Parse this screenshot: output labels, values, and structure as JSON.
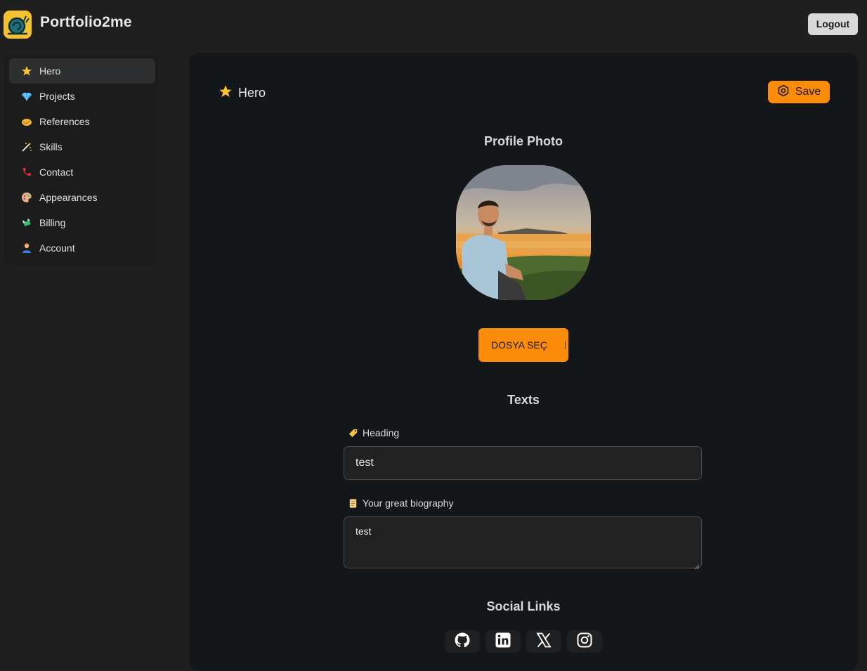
{
  "app": {
    "name": "Portfolio2me",
    "logout_label": "Logout"
  },
  "sidebar": {
    "items": [
      {
        "label": "Hero",
        "icon": "star-icon",
        "active": true
      },
      {
        "label": "Projects",
        "icon": "gem-icon"
      },
      {
        "label": "References",
        "icon": "handshake-icon"
      },
      {
        "label": "Skills",
        "icon": "magic-wand-icon"
      },
      {
        "label": "Contact",
        "icon": "telephone-icon"
      },
      {
        "label": "Appearances",
        "icon": "palette-icon"
      },
      {
        "label": "Billing",
        "icon": "money-wings-icon"
      },
      {
        "label": "Account",
        "icon": "person-icon"
      }
    ]
  },
  "main": {
    "title": "Hero",
    "save_label": "Save",
    "profile_photo_heading": "Profile Photo",
    "file_button_label": "DOSYA SEÇ",
    "texts_heading": "Texts",
    "heading_label": "Heading",
    "heading_value": "test",
    "bio_label": "Your great biography",
    "bio_value": "test",
    "social_heading": "Social Links",
    "social_links": [
      "github-icon",
      "linkedin-icon",
      "x-icon",
      "instagram-icon"
    ]
  },
  "colors": {
    "accent": "#fb8c0a",
    "panel": "#141719",
    "background": "#1f1f1f"
  }
}
